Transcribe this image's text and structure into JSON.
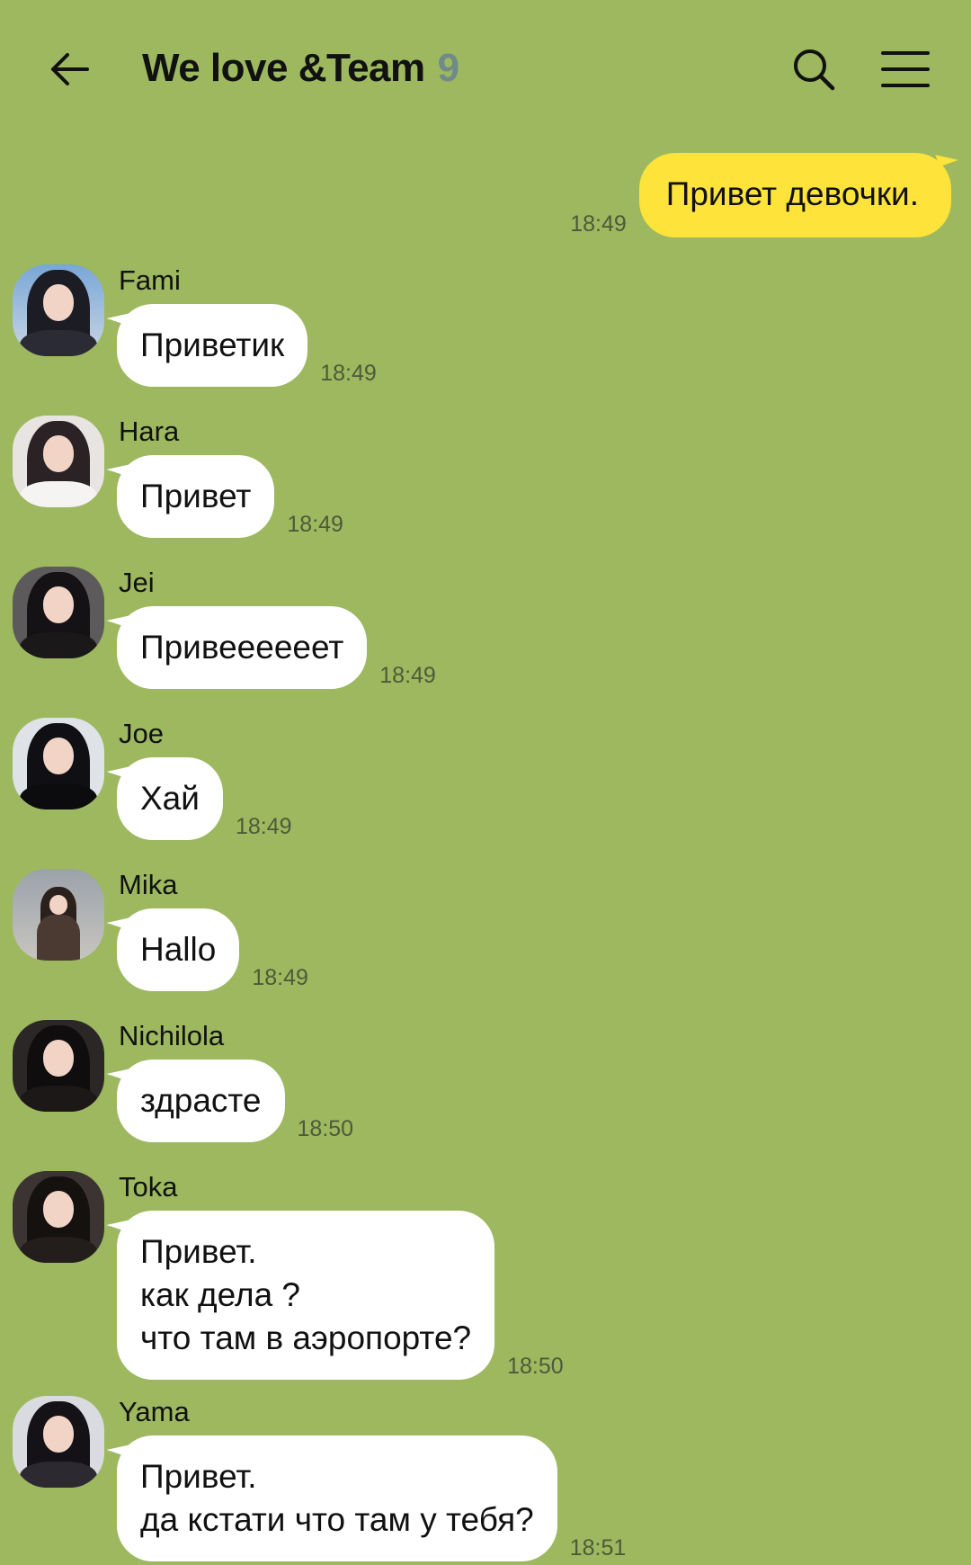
{
  "header": {
    "title": "We love &Team",
    "member_count": "9",
    "icons": [
      "arrow-left-icon",
      "search-icon",
      "hamburger-menu-icon"
    ]
  },
  "colors": {
    "background": "#9db85f",
    "outgoing_bubble": "#fde33a",
    "incoming_bubble": "#ffffff",
    "member_count": "#6f8a88"
  },
  "outgoing": [
    {
      "text": "Привет девочки.",
      "time": "18:49"
    }
  ],
  "messages": [
    {
      "sender": "Fami",
      "text": "Приветик",
      "time": "18:49"
    },
    {
      "sender": "Hara",
      "text": "Привет",
      "time": "18:49"
    },
    {
      "sender": "Jei",
      "text": "Привеееееет",
      "time": "18:49"
    },
    {
      "sender": "Joe",
      "text": "Хай",
      "time": "18:49"
    },
    {
      "sender": "Mika",
      "text": "Hallo",
      "time": "18:49"
    },
    {
      "sender": "Nichilola",
      "text": "здрасте",
      "time": "18:50"
    },
    {
      "sender": "Toka",
      "text": "Привет.\nкак дела ?\nчто там в аэропорте?",
      "time": "18:50"
    },
    {
      "sender": "Yama",
      "text": "Привет.\nда кстати что там у тебя?",
      "time": "18:51"
    }
  ]
}
